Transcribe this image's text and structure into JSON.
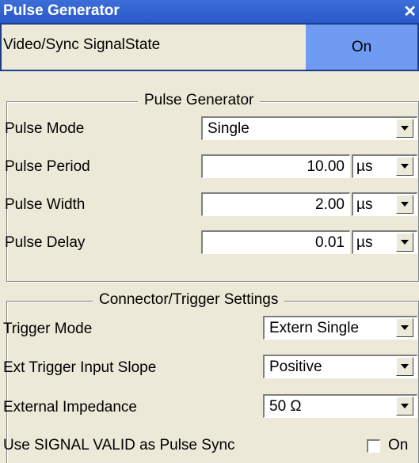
{
  "window": {
    "title": "Pulse Generator",
    "close": "✕"
  },
  "state": {
    "label": "Video/Sync SignalState",
    "value": "On"
  },
  "pulse_group": {
    "title": "Pulse Generator",
    "mode": {
      "label": "Pulse Mode",
      "value": "Single"
    },
    "period": {
      "label": "Pulse Period",
      "value": "10.00",
      "unit": "µs"
    },
    "width": {
      "label": "Pulse Width",
      "value": "2.00",
      "unit": "µs"
    },
    "delay": {
      "label": "Pulse Delay",
      "value": "0.01",
      "unit": "µs"
    }
  },
  "trigger_group": {
    "title": "Connector/Trigger Settings",
    "mode": {
      "label": "Trigger Mode",
      "value": "Extern Single"
    },
    "slope": {
      "label": "Ext Trigger Input Slope",
      "value": "Positive"
    },
    "impedance": {
      "label": "External Impedance",
      "value": "50 Ω"
    },
    "sync": {
      "label": "Use SIGNAL VALID as Pulse Sync",
      "checkbox_label": "On",
      "checked": false
    }
  }
}
